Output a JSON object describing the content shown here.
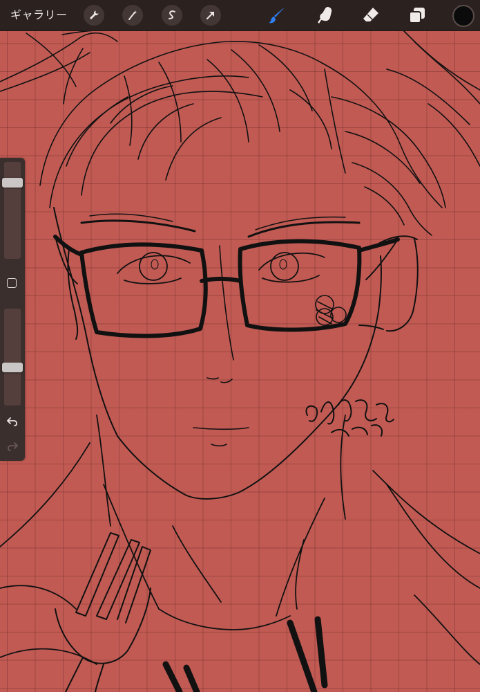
{
  "app": {
    "gallery_label": "ギャラリー"
  },
  "toolbar": {
    "actions_icon": "wrench-icon",
    "adjustments_icon": "magic-wand-icon",
    "selection_icon": "selection-s-icon",
    "transform_icon": "arrow-cursor-icon",
    "brush_icon": "brush-icon",
    "smudge_icon": "smudge-finger-icon",
    "eraser_icon": "eraser-icon",
    "layers_icon": "layers-icon",
    "active_color": "#0b0b0b",
    "brush_active_color": "#2f7ef2"
  },
  "sidebar": {
    "brush_size": 0.82,
    "opacity": 0.38,
    "undo_icon": "undo-arrow-icon",
    "redo_icon": "redo-arrow-icon"
  },
  "canvas": {
    "background_color": "#c05a53",
    "grid_color": "#461414"
  }
}
